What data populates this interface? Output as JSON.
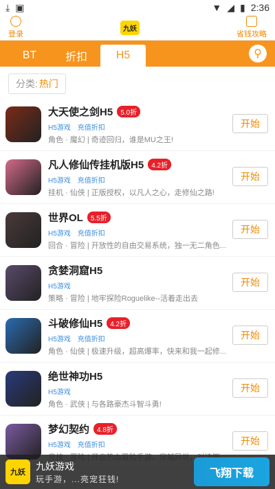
{
  "statusbar": {
    "time": "2:36",
    "left_icons": [
      "download-icon",
      "a-icon"
    ],
    "right_icons": [
      "wifi-icon",
      "signal-icon",
      "battery-icon"
    ]
  },
  "topbar": {
    "login": "登录",
    "logo": "九妖",
    "save": "省钱攻略"
  },
  "tabs": [
    {
      "label": "BT"
    },
    {
      "label": "折扣"
    },
    {
      "label": "H5"
    }
  ],
  "filter": {
    "label": "分类:",
    "value": "热门"
  },
  "games": [
    {
      "title": "大天使之剑H5",
      "badge": "5.0折",
      "tags": [
        "H5游戏",
        "充值折扣"
      ],
      "desc": "角色 · 魔幻 | 奇迹回归，谁是MU之王!",
      "btn": "开始",
      "color": "#7a2b18"
    },
    {
      "title": "凡人修仙传挂机版H5",
      "badge": "4.2折",
      "tags": [
        "H5游戏",
        "充值折扣"
      ],
      "desc": "挂机 · 仙侠 | 正版授权，以凡人之心，走修仙之路!",
      "btn": "开始",
      "color": "#d46a8a"
    },
    {
      "title": "世界OL",
      "badge": "5.5折",
      "tags": [
        "H5游戏",
        "充值折扣"
      ],
      "desc": "回合 · 冒险 | 开放性的自由交易系统，独一无二角色...",
      "btn": "开始",
      "color": "#4a3a3a"
    },
    {
      "title": "贪婪洞窟H5",
      "badge": "",
      "tags": [
        "H5游戏"
      ],
      "desc": "策略 · 冒险 | 地牢探险Roguelike--活着走出去",
      "btn": "开始",
      "color": "#5a4a6a"
    },
    {
      "title": "斗破修仙H5",
      "badge": "4.2折",
      "tags": [
        "H5游戏",
        "充值折扣"
      ],
      "desc": "角色 · 仙侠 | 极速升级，超高爆率，快来和我一起修...",
      "btn": "开始",
      "color": "#2a6bb0"
    },
    {
      "title": "绝世神功H5",
      "badge": "",
      "tags": [
        "H5游戏"
      ],
      "desc": "角色 · 武侠 | 与各路豪杰斗智斗勇!",
      "btn": "开始",
      "color": "#2a3a7a"
    },
    {
      "title": "梦幻契约",
      "badge": "4.8折",
      "tags": [
        "H5游戏",
        "充值折扣"
      ],
      "desc": "竞技 · 冒险 | 开启热血冒险手游，穿越异世，对决巅...",
      "btn": "开始",
      "color": "#7a5aa0"
    }
  ],
  "banner": {
    "logo": "九妖",
    "title": "九妖游戏",
    "sub": "玩手游，...亮宠狂钱!"
  },
  "watermark": "飞翔下载"
}
